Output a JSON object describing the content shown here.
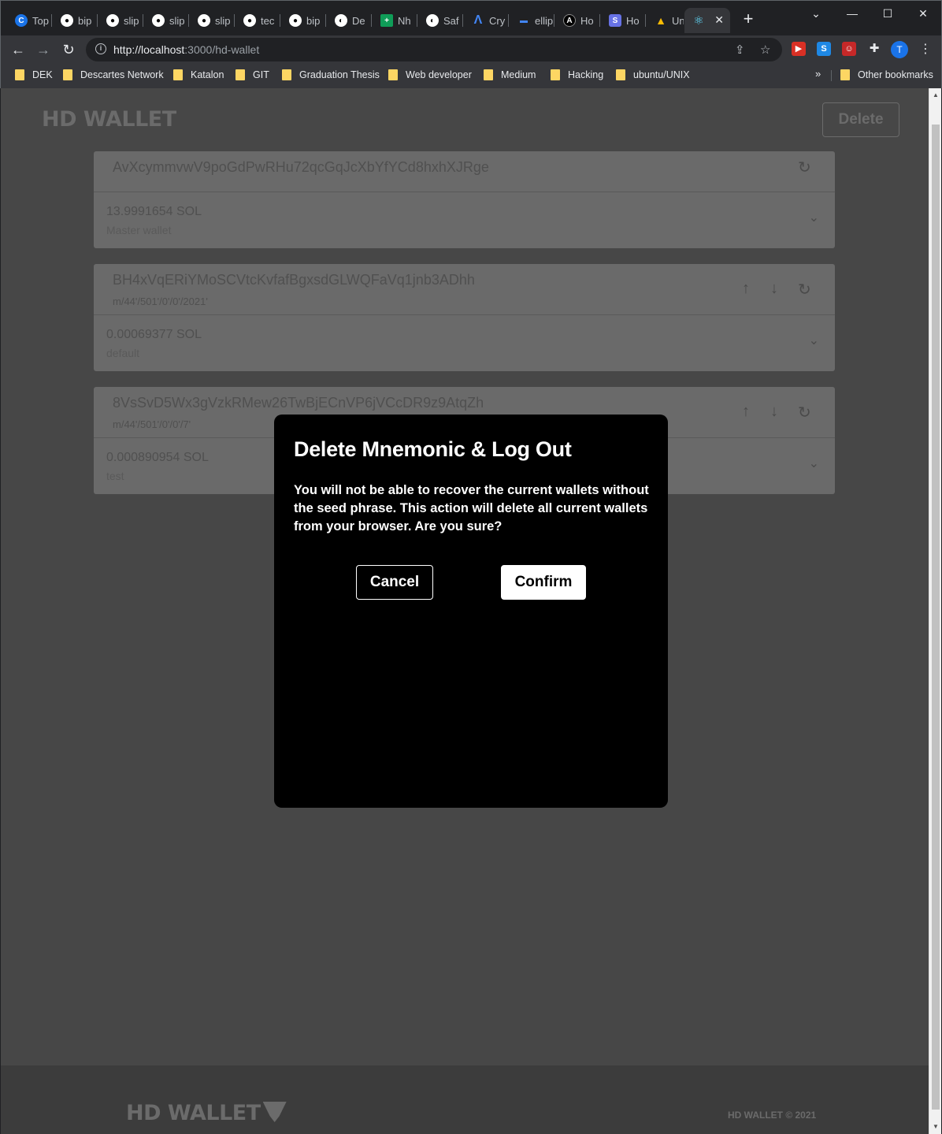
{
  "browser": {
    "tabs": [
      {
        "label": "Top",
        "icon": "c-icon",
        "color": "#1a73e8"
      },
      {
        "label": "bip",
        "icon": "github-icon",
        "color": "#ffffff"
      },
      {
        "label": "slip",
        "icon": "github-icon",
        "color": "#ffffff"
      },
      {
        "label": "slip",
        "icon": "github-icon",
        "color": "#ffffff"
      },
      {
        "label": "slip",
        "icon": "github-icon",
        "color": "#ffffff"
      },
      {
        "label": "tec",
        "icon": "github-icon",
        "color": "#ffffff"
      },
      {
        "label": "bip",
        "icon": "github-icon",
        "color": "#ffffff"
      },
      {
        "label": "De",
        "icon": "globe-icon",
        "color": "#ffffff"
      },
      {
        "label": "Nh",
        "icon": "sheets-icon",
        "color": "#0f9d58"
      },
      {
        "label": "Saf",
        "icon": "globe-icon",
        "color": "#ffffff"
      },
      {
        "label": "Cry",
        "icon": "wave-icon",
        "color": "#4285f4"
      },
      {
        "label": "ellip",
        "icon": "bar-icon",
        "color": "#4285f4"
      },
      {
        "label": "Ho",
        "icon": "a-icon",
        "color": "#000000"
      },
      {
        "label": "Ho",
        "icon": "s-icon",
        "color": "#6772e5"
      },
      {
        "label": "Unt",
        "icon": "drive-icon",
        "color": "#fbbc04"
      },
      {
        "label": "",
        "icon": "react-icon",
        "color": "#61dafb",
        "active": true
      }
    ],
    "new_tab": "+",
    "url_host": "http://localhost",
    "url_rest": ":3000/hd-wallet",
    "profile_initial": "T",
    "bookmarks": [
      "DEK",
      "Descartes Network",
      "Katalon",
      "GIT",
      "Graduation Thesis",
      "Web developer",
      "Medium",
      "Hacking",
      "ubuntu/UNIX"
    ],
    "other_bookmarks": "Other bookmarks"
  },
  "app": {
    "title": "HD WALLET",
    "delete_label": "Delete",
    "wallets": [
      {
        "address": "AvXcymmvwV9poGdPwRHu72qcGqJcXbYfYCd8hxhXJRge",
        "path": "",
        "balance": "13.9991654 SOL",
        "name": "Master wallet"
      },
      {
        "address": "BH4xVqERiYMoSCVtcKvfafBgxsdGLWQFaVq1jnb3ADhh",
        "path": "m/44'/501'/0'/0'/2021'",
        "balance": "0.00069377 SOL",
        "name": "default"
      },
      {
        "address": "8VsSvD5Wx3gVzkRMew26TwBjECnVP6jVCcDR9z9AtqZh",
        "path": "m/44'/501'/0'/0'/7'",
        "balance": "0.000890954 SOL",
        "name": "test"
      }
    ],
    "footer_logo": "HD WALLET",
    "footer_copy": "HD WALLET © 2021"
  },
  "modal": {
    "title": "Delete Mnemonic & Log Out",
    "text": "You will not be able to recover the current wallets without the seed phrase. This action will delete all current wallets from your browser. Are you sure?",
    "cancel_label": "Cancel",
    "confirm_label": "Confirm"
  }
}
